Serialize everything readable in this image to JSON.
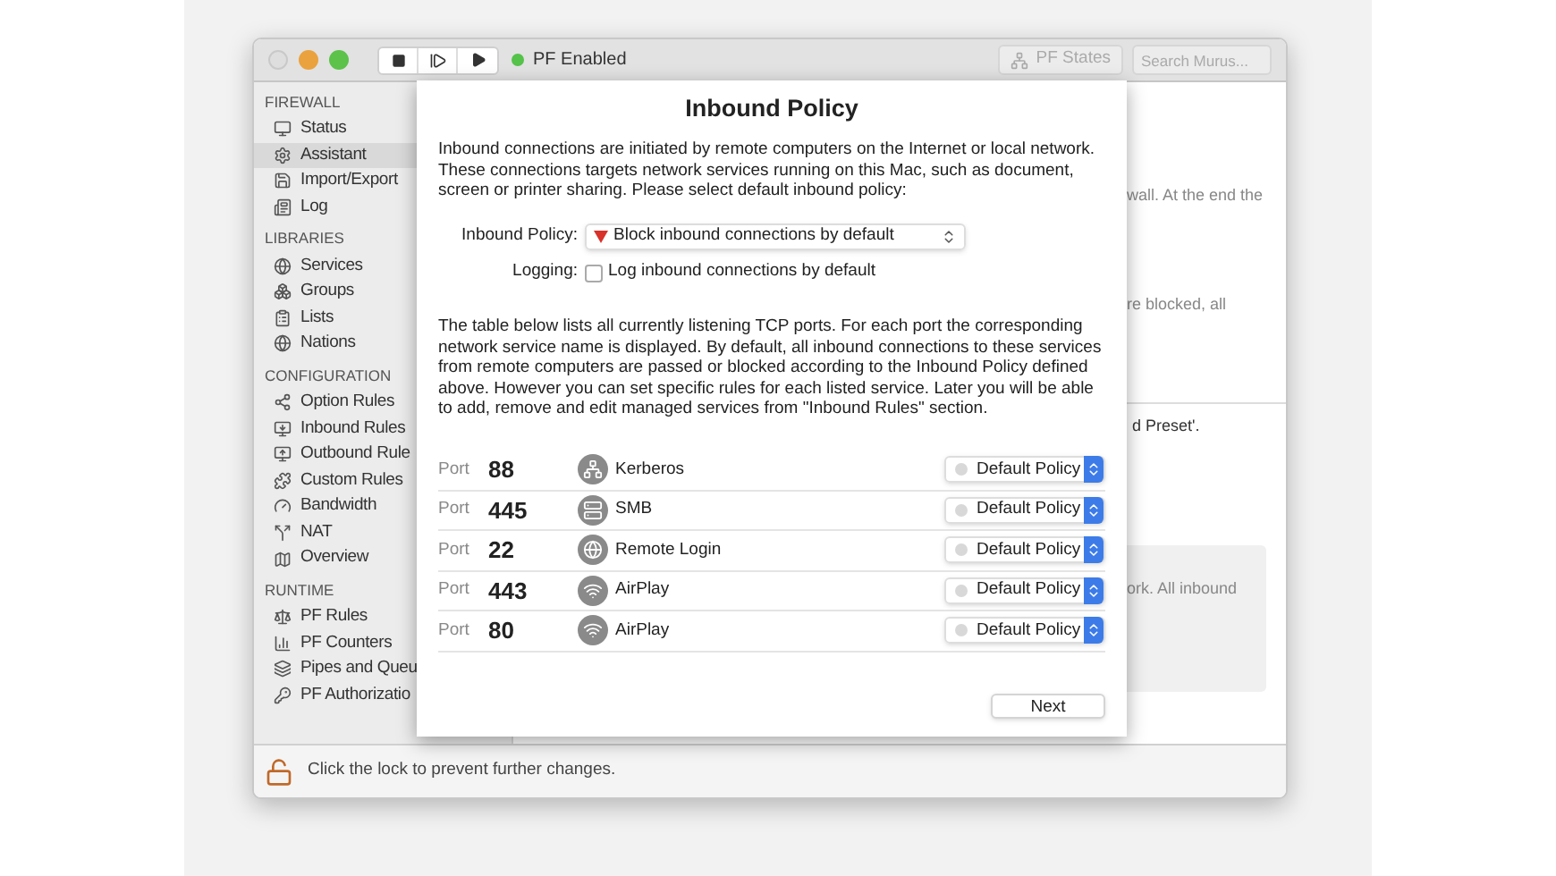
{
  "window": {
    "status": "PF Enabled",
    "states_button": "PF States",
    "search": {
      "placeholder": "Search Murus..."
    }
  },
  "sidebar": {
    "sections": [
      {
        "title": "FIREWALL",
        "items": [
          {
            "label": "Status",
            "selected": false
          },
          {
            "label": "Assistant",
            "selected": true
          },
          {
            "label": "Import/Export",
            "selected": false
          },
          {
            "label": "Log",
            "selected": false
          }
        ]
      },
      {
        "title": "LIBRARIES",
        "items": [
          {
            "label": "Services",
            "selected": false
          },
          {
            "label": "Groups",
            "selected": false
          },
          {
            "label": "Lists",
            "selected": false
          },
          {
            "label": "Nations",
            "selected": false
          }
        ]
      },
      {
        "title": "CONFIGURATION",
        "items": [
          {
            "label": "Option Rules",
            "selected": false
          },
          {
            "label": "Inbound Rules",
            "selected": false
          },
          {
            "label": "Outbound Rule",
            "selected": false
          },
          {
            "label": "Custom Rules",
            "selected": false
          },
          {
            "label": "Bandwidth",
            "selected": false
          },
          {
            "label": "NAT",
            "selected": false
          },
          {
            "label": "Overview",
            "selected": false
          }
        ]
      },
      {
        "title": "RUNTIME",
        "items": [
          {
            "label": "PF Rules",
            "selected": false
          },
          {
            "label": "PF Counters",
            "selected": false
          },
          {
            "label": "Pipes and Queu",
            "selected": false
          },
          {
            "label": "PF Authorizatio",
            "selected": false
          }
        ]
      }
    ]
  },
  "background_text": [
    {
      "text": "wall. At the end the",
      "kind": "plain"
    },
    {
      "text": "re blocked, all",
      "kind": "plain"
    },
    {
      "text": "d Preset'.",
      "kind": "divided"
    },
    {
      "text": "ork. All inbound",
      "kind": "panel"
    }
  ],
  "sheet": {
    "title": "Inbound Policy",
    "intro": "Inbound connections are initiated by remote computers on the Internet or local network. These connections targets network services running on this Mac, such as document, screen or printer sharing. Please select default inbound policy:",
    "policy": {
      "label": "Inbound Policy:",
      "value": "Block inbound connections by default"
    },
    "logging": {
      "label": "Logging:",
      "option": "Log inbound connections by default",
      "checked": false
    },
    "explanation": "The table below lists all currently listening TCP ports. For each port the corresponding network service name is displayed. By default, all inbound connections to these services from remote computers are passed or blocked according to the Inbound Policy defined above. However you can set specific rules for each listed service. Later you will be able to add, remove and edit managed services from \"Inbound Rules\" section.",
    "ports": [
      {
        "prefix": "Port",
        "number": "88",
        "service": "Kerberos",
        "policy": "Default Policy"
      },
      {
        "prefix": "Port",
        "number": "445",
        "service": "SMB",
        "policy": "Default Policy"
      },
      {
        "prefix": "Port",
        "number": "22",
        "service": "Remote Login",
        "policy": "Default Policy"
      },
      {
        "prefix": "Port",
        "number": "443",
        "service": "AirPlay",
        "policy": "Default Policy"
      },
      {
        "prefix": "Port",
        "number": "80",
        "service": "AirPlay",
        "policy": "Default Policy"
      }
    ],
    "next": "Next"
  },
  "footer": "Click the lock to prevent further changes."
}
